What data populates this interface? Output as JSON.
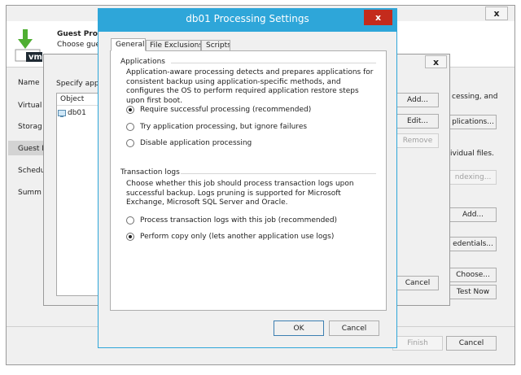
{
  "bg_window": {
    "close_label": "x",
    "header_title": "Guest Proc",
    "header_subtitle": "Choose gue",
    "logo_text": "vm",
    "nav": [
      "Name",
      "Virtual",
      "Storag",
      "Guest P",
      "Schedu",
      "Summ"
    ],
    "right_labels": {
      "processing": "cessing, and",
      "individual": "ividual files."
    },
    "buttons": {
      "applications": "plications...",
      "indexing": "ndexing...",
      "add": "Add...",
      "credentials": "edentials...",
      "choose": "Choose...",
      "test_now": "Test Now",
      "finish": "Finish",
      "cancel": "Cancel"
    }
  },
  "mid_window": {
    "close_label": "x",
    "label": "Specify appl",
    "column_header": "Object",
    "rows": [
      "db01"
    ],
    "buttons": {
      "add": "Add...",
      "edit": "Edit...",
      "remove": "Remove",
      "cancel": "Cancel"
    }
  },
  "dialog": {
    "title": "db01 Processing Settings",
    "close_label": "x",
    "tabs": [
      "General",
      "File Exclusions",
      "Scripts"
    ],
    "applications": {
      "group_title": "Applications",
      "description": "Application-aware processing detects and prepares applications for consistent backup using application-specific methods, and configures the OS to perform required application restore steps upon first boot.",
      "options": [
        "Require successful processing  (recommended)",
        "Try application processing, but ignore failures",
        "Disable application processing"
      ],
      "selected_index": 0
    },
    "transaction_logs": {
      "group_title": "Transaction logs",
      "description": "Choose whether this job should process transaction logs upon successful backup. Logs pruning is supported for Microsoft Exchange, Microsoft SQL Server and Oracle.",
      "options": [
        "Process transaction logs with this job (recommended)",
        "Perform copy only (lets another application use logs)"
      ],
      "selected_index": 1
    },
    "ok_label": "OK",
    "cancel_label": "Cancel"
  },
  "colors": {
    "accent": "#2ea6d9",
    "close_red": "#c42b1c",
    "logo_green": "#4fae32",
    "selection": "#d3d3d3"
  }
}
